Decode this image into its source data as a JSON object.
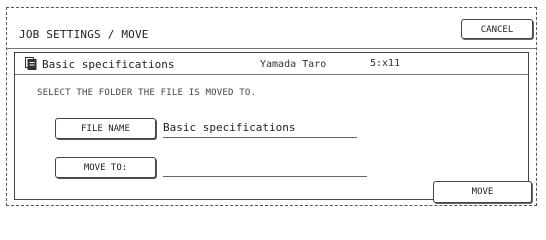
{
  "window": {
    "title": "JOB SETTINGS / MOVE",
    "cancel_label": "CANCEL"
  },
  "job": {
    "icon": "document-icon",
    "name": "Basic specifications",
    "user": "Yamada Taro",
    "pages": "5:x11"
  },
  "instruction": "SELECT THE FOLDER THE FILE IS MOVED TO.",
  "file_name": {
    "button_label": "FILE NAME",
    "value": "Basic specifications"
  },
  "move_to": {
    "button_label": "MOVE TO:",
    "value": ""
  },
  "actions": {
    "move_label": "MOVE"
  }
}
